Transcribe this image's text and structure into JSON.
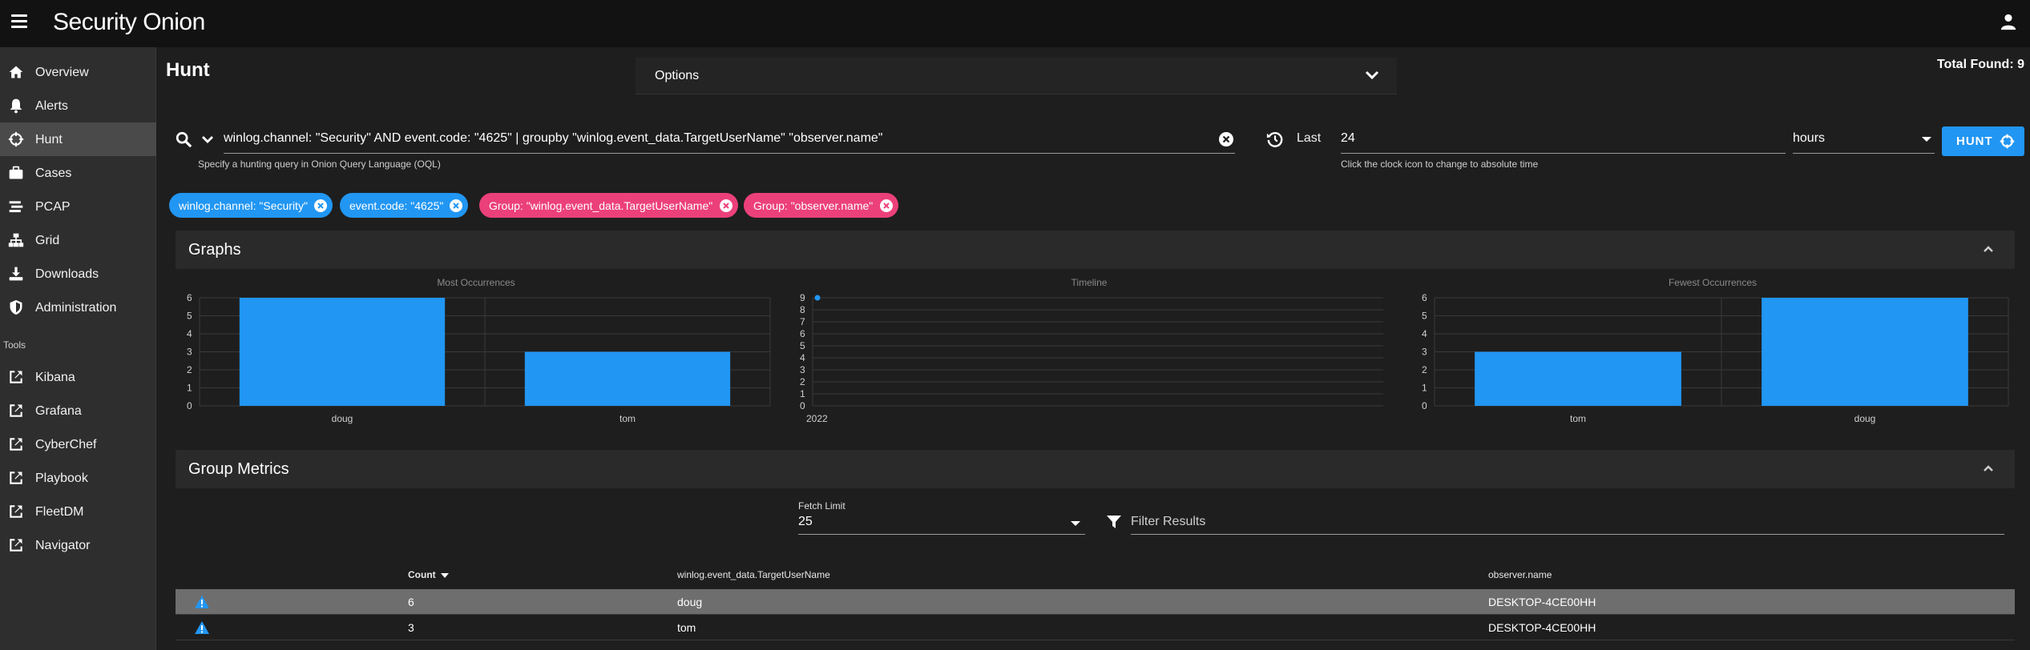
{
  "app": {
    "brand": "Security Onion"
  },
  "sidebar": {
    "items": [
      {
        "label": "Overview",
        "icon": "home-icon"
      },
      {
        "label": "Alerts",
        "icon": "bell-icon"
      },
      {
        "label": "Hunt",
        "icon": "crosshairs-icon",
        "active": true
      },
      {
        "label": "Cases",
        "icon": "briefcase-icon"
      },
      {
        "label": "PCAP",
        "icon": "stream-icon"
      },
      {
        "label": "Grid",
        "icon": "sitemap-icon"
      },
      {
        "label": "Downloads",
        "icon": "download-icon"
      },
      {
        "label": "Administration",
        "icon": "shield-icon"
      }
    ],
    "tools_header": "Tools",
    "tools": [
      {
        "label": "Kibana",
        "icon": "external-link-icon"
      },
      {
        "label": "Grafana",
        "icon": "external-link-icon"
      },
      {
        "label": "CyberChef",
        "icon": "external-link-icon"
      },
      {
        "label": "Playbook",
        "icon": "external-link-icon"
      },
      {
        "label": "FleetDM",
        "icon": "external-link-icon"
      },
      {
        "label": "Navigator",
        "icon": "external-link-icon"
      }
    ]
  },
  "page": {
    "title": "Hunt",
    "options_label": "Options",
    "total_found": "Total Found: 9"
  },
  "query": {
    "value": "winlog.channel: \"Security\" AND event.code: \"4625\" | groupby \"winlog.event_data.TargetUserName\" \"observer.name\"",
    "hint": "Specify a hunting query in Onion Query Language (OQL)"
  },
  "time": {
    "last_label": "Last",
    "value": "24",
    "unit": "hours",
    "hint": "Click the clock icon to change to absolute time",
    "hunt_label": "HUNT"
  },
  "chips": [
    {
      "label": "winlog.channel: \"Security\"",
      "color": "#2196f3"
    },
    {
      "label": "event.code: \"4625\"",
      "color": "#2196f3"
    },
    {
      "label": "Group: \"winlog.event_data.TargetUserName\"",
      "color": "#ec407a"
    },
    {
      "label": "Group: \"observer.name\"",
      "color": "#ec407a"
    }
  ],
  "graphs": {
    "title": "Graphs",
    "accent": "#2196f3"
  },
  "chart_data": [
    {
      "type": "bar",
      "title": "Most Occurrences",
      "categories": [
        "doug",
        "tom"
      ],
      "values": [
        6,
        3
      ],
      "yticks": [
        "0",
        "1",
        "2",
        "3",
        "4",
        "5",
        "6"
      ],
      "ylim": [
        0,
        6
      ]
    },
    {
      "type": "line",
      "title": "Timeline",
      "x": [
        "2022"
      ],
      "values": [
        9
      ],
      "yticks": [
        "0",
        "1",
        "2",
        "3",
        "4",
        "5",
        "6",
        "7",
        "8",
        "9"
      ],
      "ylim": [
        0,
        9
      ]
    },
    {
      "type": "bar",
      "title": "Fewest Occurrences",
      "categories": [
        "tom",
        "doug"
      ],
      "values": [
        3,
        6
      ],
      "yticks": [
        "0",
        "1",
        "2",
        "3",
        "4",
        "5",
        "6"
      ],
      "ylim": [
        0,
        6
      ]
    }
  ],
  "metrics": {
    "title": "Group Metrics",
    "fetch_limit_label": "Fetch Limit",
    "fetch_limit": "25",
    "filter_placeholder": "Filter Results",
    "columns": [
      "Count",
      "winlog.event_data.TargetUserName",
      "observer.name"
    ],
    "rows": [
      {
        "count": "6",
        "user": "doug",
        "observer": "DESKTOP-4CE00HH"
      },
      {
        "count": "3",
        "user": "tom",
        "observer": "DESKTOP-4CE00HH"
      }
    ]
  }
}
